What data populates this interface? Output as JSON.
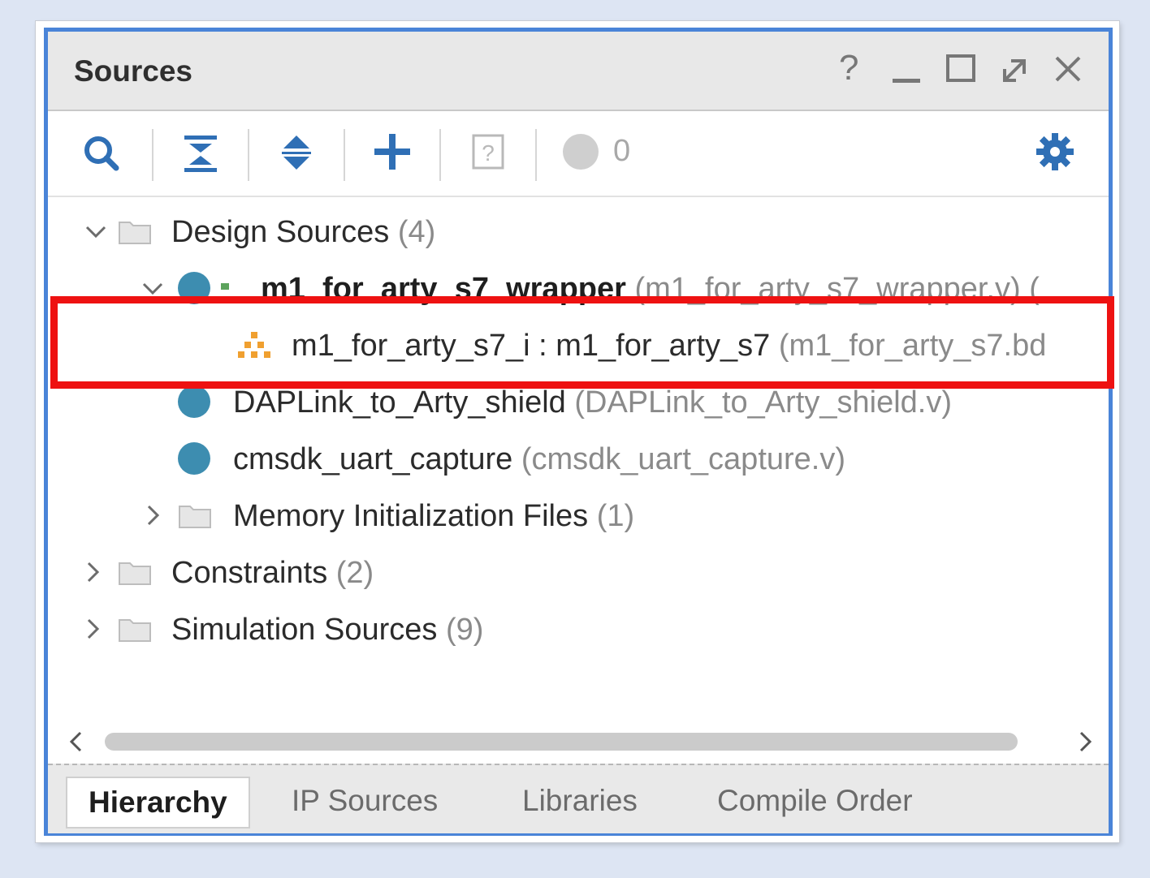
{
  "window": {
    "title": "Sources",
    "controls": {
      "help": "?",
      "minimize": "_",
      "maximize": "□",
      "float": "⇱",
      "close": "×"
    }
  },
  "toolbar": {
    "issue_count": "0",
    "icons": [
      "search-icon",
      "collapse-all-icon",
      "expand-all-icon",
      "add-icon",
      "help-doc-icon",
      "status-indicator-icon",
      "gear-icon"
    ]
  },
  "tree": {
    "design_sources": {
      "label": "Design Sources",
      "count": "(4)"
    },
    "wrapper": {
      "label": "m1_for_arty_s7_wrapper",
      "file": "(m1_for_arty_s7_wrapper.v) ("
    },
    "bd_instance": {
      "label": "m1_for_arty_s7_i : m1_for_arty_s7",
      "file": "(m1_for_arty_s7.bd"
    },
    "daplink": {
      "label": "DAPLink_to_Arty_shield",
      "file": "(DAPLink_to_Arty_shield.v)"
    },
    "uart": {
      "label": "cmsdk_uart_capture",
      "file": "(cmsdk_uart_capture.v)"
    },
    "mem_init": {
      "label": "Memory Initialization Files",
      "count": "(1)"
    },
    "constraints": {
      "label": "Constraints",
      "count": "(2)"
    },
    "sim_sources": {
      "label": "Simulation Sources",
      "count": "(9)"
    }
  },
  "tabs": [
    "Hierarchy",
    "IP Sources",
    "Libraries",
    "Compile Order"
  ],
  "colors": {
    "accent_border": "#4a84d8",
    "highlight": "#ee1111",
    "module_dot": "#3d8db0",
    "bd_icon": "#f0a030"
  }
}
